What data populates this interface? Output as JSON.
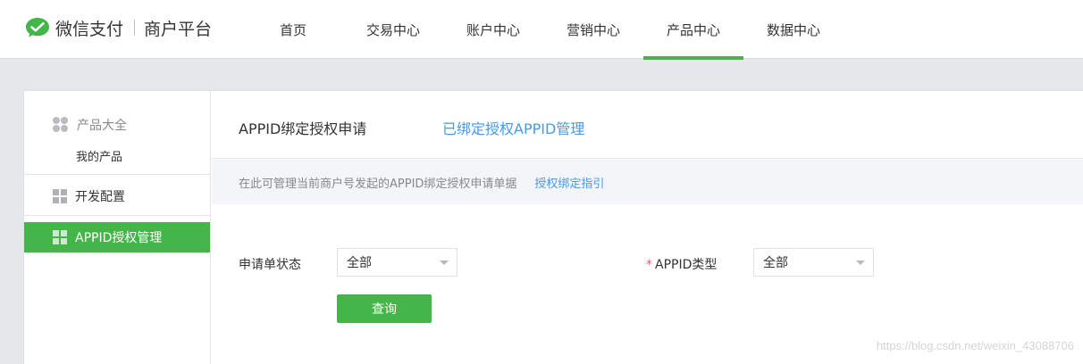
{
  "header": {
    "brand": "微信支付",
    "brand_sub": "商户平台",
    "nav": [
      {
        "label": "首页"
      },
      {
        "label": "交易中心"
      },
      {
        "label": "账户中心"
      },
      {
        "label": "营销中心"
      },
      {
        "label": "产品中心",
        "active": true
      },
      {
        "label": "数据中心"
      }
    ]
  },
  "sidebar": {
    "group_title": "产品大全",
    "group_sub": "我的产品",
    "item_dev": "开发配置",
    "item_appid": "APPID授权管理"
  },
  "main": {
    "tab_title": "APPID绑定授权申请",
    "tab_link": "已绑定授权APPID管理",
    "tip_text": "在此可管理当前商户号发起的APPID绑定授权申请单据",
    "tip_link": "授权绑定指引",
    "form": {
      "status_label": "申请单状态",
      "status_value": "全部",
      "type_required": "*",
      "type_label": "APPID类型",
      "type_value": "全部",
      "query_button": "查询"
    }
  },
  "watermark": "https://blog.csdn.net/weixin_43088706",
  "colors": {
    "accent": "#44b549",
    "link": "#459ae9",
    "required": "#e15f63"
  }
}
